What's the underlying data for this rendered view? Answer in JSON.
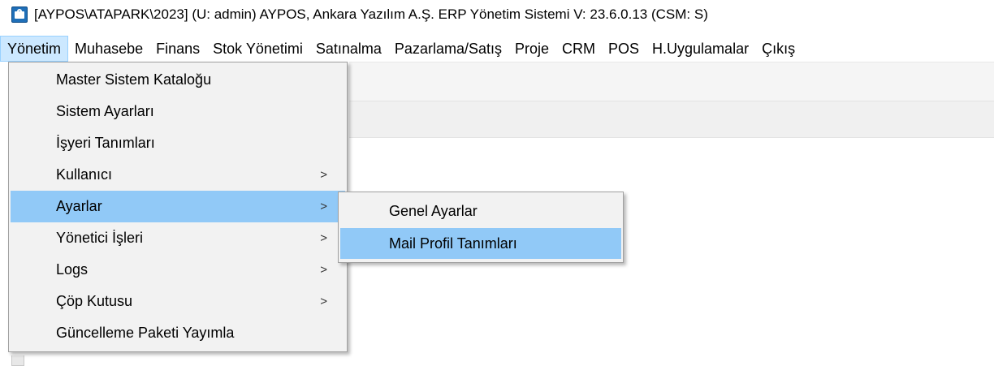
{
  "window": {
    "title": "[AYPOS\\ATAPARK\\2023] (U: admin) AYPOS, Ankara Yazılım A.Ş. ERP Yönetim Sistemi V: 23.6.0.13 (CSM: S)"
  },
  "menubar": {
    "items": [
      {
        "label": "Yönetim"
      },
      {
        "label": "Muhasebe"
      },
      {
        "label": "Finans"
      },
      {
        "label": "Stok Yönetimi"
      },
      {
        "label": "Satınalma"
      },
      {
        "label": "Pazarlama/Satış"
      },
      {
        "label": "Proje"
      },
      {
        "label": "CRM"
      },
      {
        "label": "POS"
      },
      {
        "label": "H.Uygulamalar"
      },
      {
        "label": "Çıkış"
      }
    ]
  },
  "dropdown": {
    "items": [
      {
        "label": "Master Sistem Kataloğu"
      },
      {
        "label": "Sistem Ayarları"
      },
      {
        "label": "İşyeri Tanımları"
      },
      {
        "label": "Kullanıcı",
        "chevron": ">"
      },
      {
        "label": "Ayarlar",
        "chevron": ">"
      },
      {
        "label": "Yönetici İşleri",
        "chevron": ">"
      },
      {
        "label": "Logs",
        "chevron": ">"
      },
      {
        "label": "Çöp Kutusu",
        "chevron": ">"
      },
      {
        "label": "Güncelleme Paketi Yayımla"
      }
    ]
  },
  "submenu": {
    "items": [
      {
        "label": "Genel Ayarlar"
      },
      {
        "label": "Mail Profil Tanımları"
      }
    ]
  },
  "colors": {
    "highlight": "#91c9f7",
    "menubar_active": "#cce8ff",
    "menu_bg": "#f2f2f2"
  },
  "icons": {
    "app": "app-icon",
    "submenu_arrow": "chevron-right-icon"
  }
}
